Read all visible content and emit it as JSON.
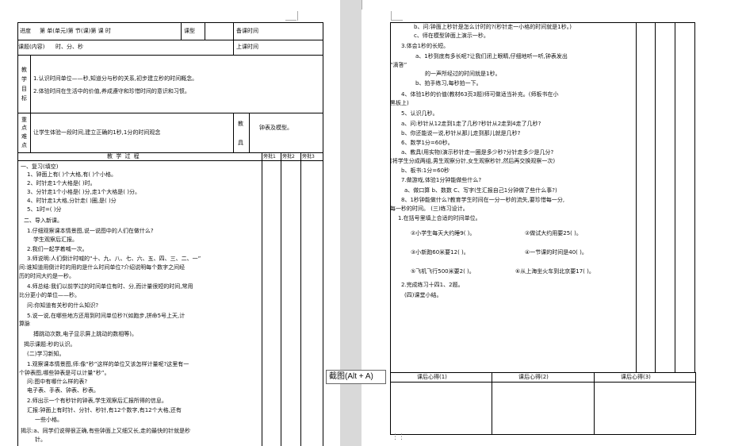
{
  "left": {
    "header": {
      "subject": "进度",
      "unit": "第 单(单元)第 节(课)第 课 时",
      "type": "课型",
      "prep_time": "备课时间",
      "topic_label": "课题(内容)",
      "topic": "时、分、秒",
      "class_time": "上课时间",
      "goals_label": [
        "教",
        "学",
        "目",
        "标"
      ],
      "goal1": "1.认识时间单位——秒,知道分与秒的关系,初步建立秒的时间概念。",
      "goal2": "2.体验时间在生活中的价值,养成遵守和珍惜时间的意识和习惯。",
      "key_label": [
        "重",
        "点",
        "难",
        "点"
      ],
      "key_text": "让学生体验一段时间,建立正确的1秒,1分的时间观念",
      "tools_label": [
        "教",
        "具"
      ],
      "tools_text": "钟表及模型。",
      "process": "教 学 过 程",
      "rev1": "旁批1",
      "rev2": "旁批2",
      "rev3": "旁批3"
    },
    "body": [
      "一、复习(填空)",
      "1、钟面上有( )个大格,有( )个小格。",
      "2、时针走1个大格是( )时。",
      "3、分针走1个小格是( )分,走1个大格是( )分。",
      "4、时针走1大格,分针走( )圈,是( )分",
      "5、1时=( )分",
      "二、导入新课。",
      "1.仔细观察课本情景图,说一说图中的人们在做什么?",
      "学生观察后汇报。",
      "2.我们一起学着喊一次。",
      "3.师说明:人们倒计时喊的“十、九、八、七、六、五、四、三、二、一”",
      "间:谁知道用倒计时的用的是什么时间单位?介绍说明每个数字之间经",
      "历的时间大约是一秒。",
      "4.师总结:我们以前学过的时间单位有时、分,而计量很短的时间,常用",
      "比分更小的单位——秒。",
      "问:你知道有关秒的什么知识?",
      "5.说一说,在哪些地方还用到时间单位秒?(如跑步,拼命5号上天,计",
      "算脉",
      "搏跳动次数,电子显示屏上跳动的数相等)。",
      "揭示课题:秒的认识。",
      "(二)学习新知。",
      "1.观察课本情景图,师:像“秒”这样的单位又该怎样计量呢?这里有一",
      "个钟表图,哪些钟表是可以计量“秒”。",
      "问:图中有哪什么样的表?",
      "电子表、手表、钟表、秒表。",
      "2.师出示一个有秒针的钟表,学生观察后汇报所得的信息。",
      "汇报:钟面上有时针、分针、秒针,有12个数字,有12个大格,还有",
      "一些小格。",
      "揭示:a、同学们说得很正确,有些钟面上又细又长,走的最快的针就是秒",
      "针。"
    ]
  },
  "right": {
    "body": [
      "c、师在模型钟面上演示一秒。",
      "3.体会1秒的长短。",
      "a、1秒到底有多长呢?让我们闭上眼睛,仔细地听一听,钟表发出",
      "“滴答”",
      "的一声所经过的时间就是1秒。",
      "b、拍手练习,每秒拍一下。",
      "4、体验1秒的价值(教材63页3题)师可做适当补充。(师板书在小",
      "黑板上)",
      "5、认识几秒。",
      "a、问:秒针从12走到1走了几秒?秒针从2走到4走了几秒?",
      "b、你还能说一说,秒针从那儿走到那儿就是几秒?",
      "6、数学1分=60秒。",
      "a、教具(用实物)演示秒针走一圈是多少秒?分针走多少是几分?",
      "(将学生分成两组,男生观察分针,女生观察秒针,然后再交换观察一次)",
      "b、板书:1分=60秒",
      "7.做游戏,体验1分钟能做些什么?",
      "a、做口算 b、数数 C、写字(生汇报自己1分钟做了些什么事?)",
      "8、1秒钟能做什么?教育学生时间在一分一秒的流失,要珍惜每一分,",
      "每一秒的时间。 (三)练习设计。",
      "1.在括号里填上合适的时间单位。",
      "②小学生每天大约睡9( )。",
      "②做试大约用要25( )。",
      "③小新跑60米要12( )。",
      "④一节课的时间是40( )。",
      "⑤飞机飞行500米要2( )。",
      "⑥从上海坐火车到北京要17( )。",
      "2.完成练习十四1、2题。",
      "(四)课堂小结。"
    ],
    "top_partial": "b、问:钟面上秒针是怎么计时的?(秒针走一小格的时间就是1秒。)",
    "reflection1": "课后心得(1)",
    "reflection2": "课后心得(2)",
    "reflection3": "课后心得(3)"
  },
  "tooltip": "截图(Alt + A)",
  "grip": "⋮⋮"
}
